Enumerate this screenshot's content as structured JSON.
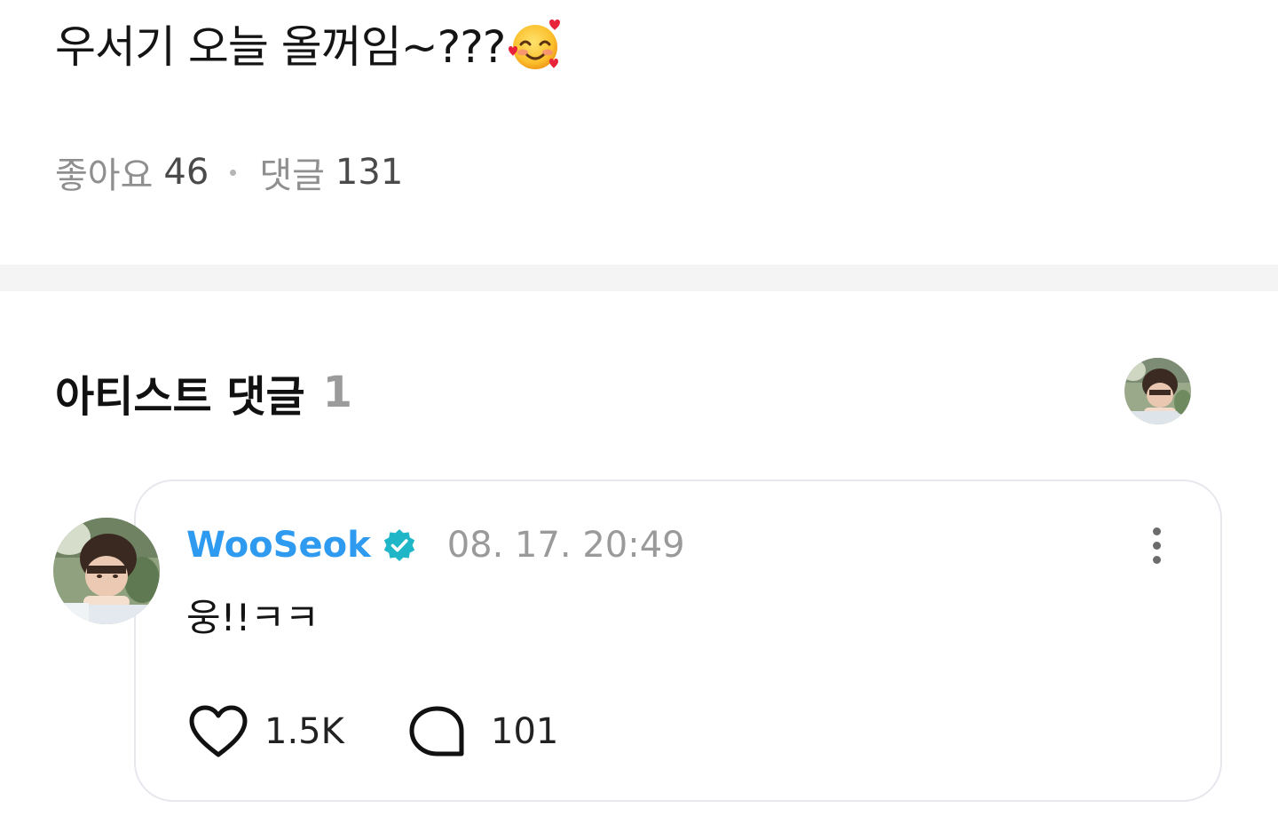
{
  "post": {
    "text": "우서기 오늘 올꺼임~???",
    "emoji": "smiling-face-with-hearts",
    "likes_label": "좋아요",
    "likes_count": "46",
    "comments_label": "댓글",
    "comments_count": "131"
  },
  "artist_comments": {
    "title": "아티스트 댓글",
    "count": "1"
  },
  "comment": {
    "author": "WooSeok",
    "verified": true,
    "timestamp": "08. 17. 20:49",
    "text": "웅!!ㅋㅋ",
    "like_count": "1.5K",
    "reply_count": "101"
  },
  "colors": {
    "author": "#2e9bf0",
    "verified_badge": "#1fb7c8",
    "muted_text": "#8f8f8f",
    "divider": "#f4f4f4",
    "card_border": "#e6e8ee"
  }
}
